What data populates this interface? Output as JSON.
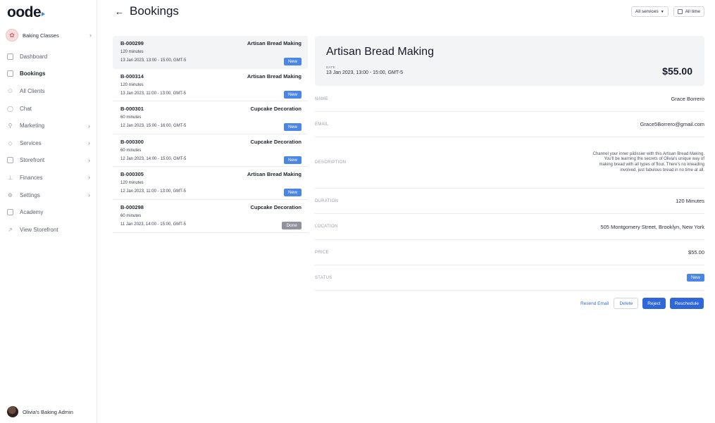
{
  "brand": {
    "logo_text": "oode"
  },
  "sidebar": {
    "business": {
      "name": "Baking Classes"
    },
    "items": [
      {
        "label": "Dashboard",
        "icon": "dashboard-icon",
        "chevron": false,
        "active": false
      },
      {
        "label": "Bookings",
        "icon": "calendar-icon",
        "chevron": false,
        "active": true
      },
      {
        "label": "All Clients",
        "icon": "users-icon",
        "chevron": false,
        "active": false
      },
      {
        "label": "Chat",
        "icon": "chat-icon",
        "chevron": false,
        "active": false
      },
      {
        "label": "Marketing",
        "icon": "megaphone-icon",
        "chevron": true,
        "active": false
      },
      {
        "label": "Services",
        "icon": "services-icon",
        "chevron": true,
        "active": false
      },
      {
        "label": "Storefront",
        "icon": "storefront-icon",
        "chevron": true,
        "active": false
      },
      {
        "label": "Finances",
        "icon": "finances-icon",
        "chevron": true,
        "active": false
      },
      {
        "label": "Settings",
        "icon": "gear-icon",
        "chevron": true,
        "active": false
      },
      {
        "label": "Academy",
        "icon": "academy-icon",
        "chevron": false,
        "active": false
      },
      {
        "label": "View Storefront",
        "icon": "external-link-icon",
        "chevron": false,
        "active": false
      }
    ],
    "user": {
      "name": "Olivia's Baking Admin"
    }
  },
  "header": {
    "title": "Bookings",
    "filters": {
      "services": "All services",
      "time": "All time"
    }
  },
  "bookings": [
    {
      "id": "B-000299",
      "service": "Artisan Bread Making",
      "duration": "120 minutes",
      "datetime": "13 Jan 2023, 13:00 - 15:00, GMT-5",
      "status": "New",
      "selected": true
    },
    {
      "id": "B-000314",
      "service": "Artisan Bread Making",
      "duration": "120 minutes",
      "datetime": "13 Jan 2023, 11:00 - 13:00, GMT-5",
      "status": "New",
      "selected": false
    },
    {
      "id": "B-000301",
      "service": "Cupcake Decoration",
      "duration": "60 minutes",
      "datetime": "12 Jan 2023, 15:00 - 16:00, GMT-5",
      "status": "New",
      "selected": false
    },
    {
      "id": "B-000300",
      "service": "Cupcake Decoration",
      "duration": "60 minutes",
      "datetime": "12 Jan 2023, 14:00 - 15:00, GMT-5",
      "status": "New",
      "selected": false
    },
    {
      "id": "B-000305",
      "service": "Artisan Bread Making",
      "duration": "120 minutes",
      "datetime": "12 Jan 2023, 11:00 - 13:00, GMT-5",
      "status": "New",
      "selected": false
    },
    {
      "id": "B-000298",
      "service": "Cupcake Decoration",
      "duration": "60 minutes",
      "datetime": "11 Jan 2023, 14:00 - 15:00, GMT-5",
      "status": "Done",
      "selected": false
    }
  ],
  "detail": {
    "title": "Artisan Bread Making",
    "date_label": "DATE",
    "date": "13 Jan 2023, 13:00 - 15:00, GMT-5",
    "price": "$55.00",
    "fields": {
      "name": {
        "label": "NAME",
        "value": "Grace Borrero"
      },
      "email": {
        "label": "EMAIL",
        "value": "Grace5Borrero@gmail.com"
      },
      "description": {
        "label": "DESCRIPTION",
        "value": "Channel your inner pâtissier with this Artisan Bread Making. You'll be learning the secrets of Olivia's unique way of making bread with all types of flour. There's no kneading involved, just fabulous bread in no time at all."
      },
      "duration": {
        "label": "DURATION",
        "value": "120 Minutes"
      },
      "location": {
        "label": "LOCATION",
        "value": "505 Montgomery Street, Brooklyn, New York"
      },
      "price": {
        "label": "PRICE",
        "value": "$55.00"
      },
      "status": {
        "label": "STATUS",
        "value": "New"
      }
    },
    "actions": {
      "resend": "Resend Email",
      "delete": "Delete",
      "reject": "Reject",
      "reschedule": "Reschedule"
    }
  },
  "colors": {
    "accent": "#2f66d9",
    "badge_new": "#4a86e8",
    "badge_done": "#8e939c",
    "panel_bg": "#f3f4f6"
  }
}
